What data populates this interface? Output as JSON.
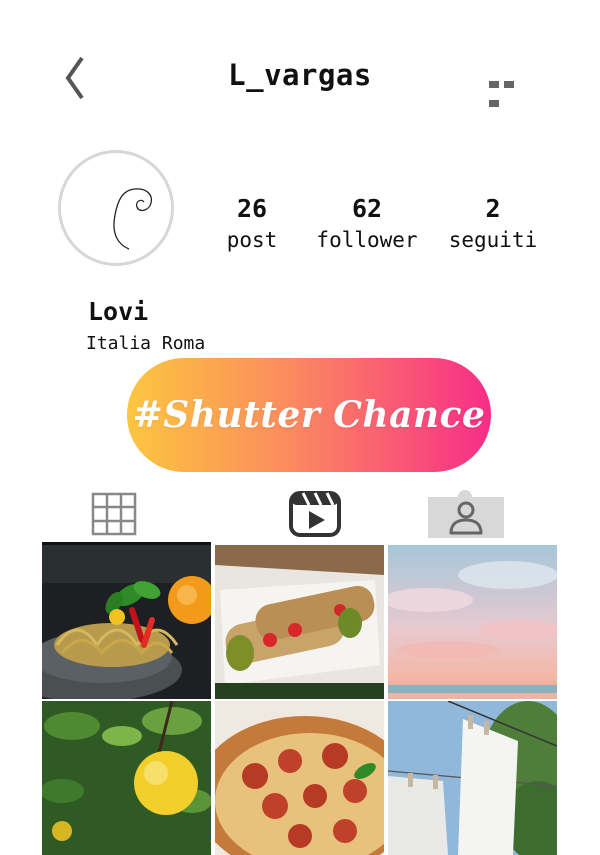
{
  "header": {
    "username": "L_vargas",
    "back_icon": "chevron-left-icon",
    "more_icon": "more-horizontal-icon"
  },
  "profile": {
    "display_name": "Lovi",
    "location": "Italia Roma",
    "stats": [
      {
        "value": "26",
        "label": "post"
      },
      {
        "value": "62",
        "label": "follower"
      },
      {
        "value": "2",
        "label": "seguiti"
      }
    ]
  },
  "banner": {
    "text": "#Shutter Chance",
    "gradient": [
      "#fcc63f",
      "#fb8a5f",
      "#f72d88"
    ]
  },
  "tabs": [
    {
      "icon": "grid-icon",
      "active": true
    },
    {
      "icon": "reels-icon",
      "active": false
    },
    {
      "icon": "tagged-user-icon",
      "active": false
    }
  ],
  "posts": [
    {
      "subject": "spaghetti-pasta-photo"
    },
    {
      "subject": "cannoli-pastry-photo"
    },
    {
      "subject": "pastel-sky-photo"
    },
    {
      "subject": "lemon-tree-photo"
    },
    {
      "subject": "pepperoni-pizza-photo"
    },
    {
      "subject": "laundry-line-photo"
    }
  ]
}
